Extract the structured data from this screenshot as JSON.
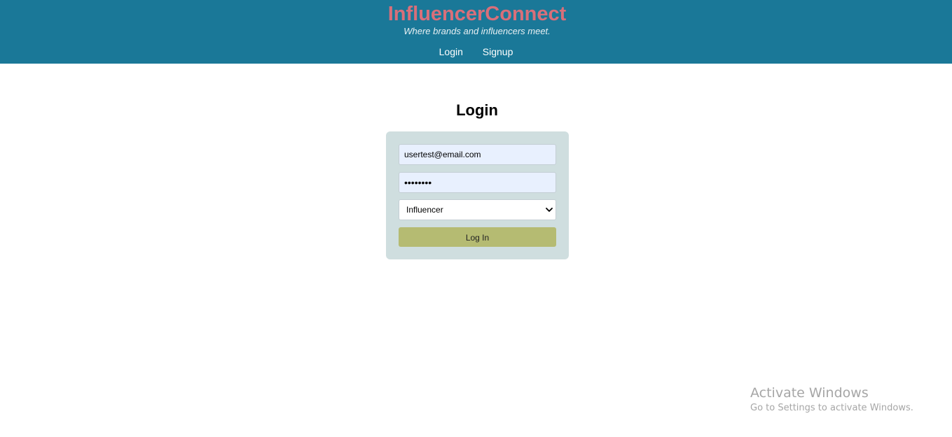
{
  "header": {
    "brand": "InfluencerConnect",
    "tagline": "Where brands and influencers meet.",
    "nav": {
      "login": "Login",
      "signup": "Signup"
    }
  },
  "main": {
    "title": "Login",
    "form": {
      "email_value": "usertest@email.com",
      "password_value": "••••••••",
      "role_selected": "Influencer",
      "submit_label": "Log In"
    }
  },
  "watermark": {
    "title": "Activate Windows",
    "subtitle": "Go to Settings to activate Windows."
  },
  "colors": {
    "header_bg": "#1a7898",
    "brand": "#d86f7a",
    "card_bg": "#cfdedf",
    "button_bg": "#b5bb72"
  }
}
